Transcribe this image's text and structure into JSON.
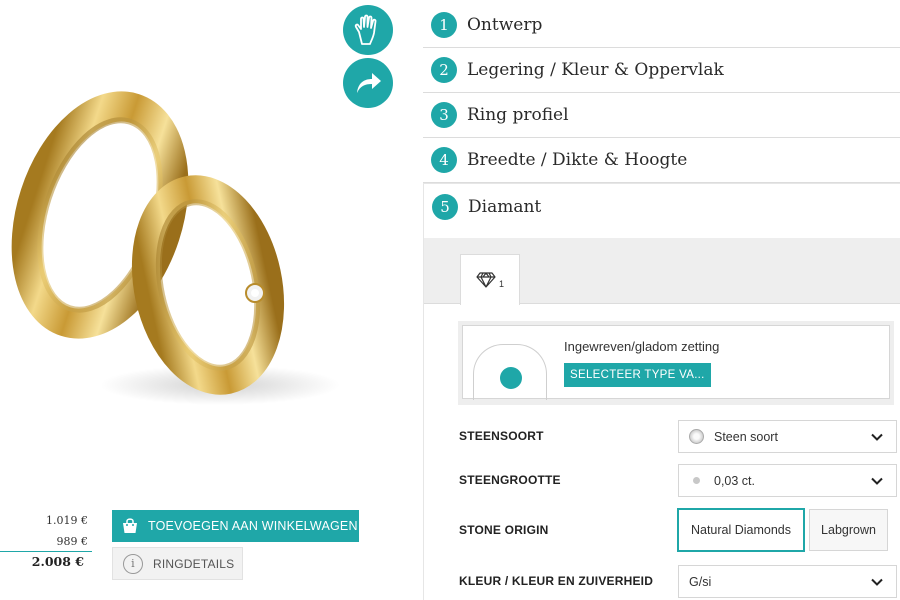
{
  "steps": [
    {
      "num": "1",
      "label": "Ontwerp"
    },
    {
      "num": "2",
      "label": "Legering / Kleur & Oppervlak"
    },
    {
      "num": "3",
      "label": "Ring profiel"
    },
    {
      "num": "4",
      "label": "Breedte / Dikte & Hoogte"
    },
    {
      "num": "5",
      "label": "Diamant"
    }
  ],
  "active_step": "5",
  "tabs": [
    {
      "icon": "diamond-icon",
      "count": "1"
    }
  ],
  "setting": {
    "title": "Ingewreven/gladom zetting",
    "button": "SELECTEER TYPE VA..."
  },
  "options": {
    "stone_type": {
      "label": "STEENSOORT",
      "value": "Steen soort"
    },
    "stone_size": {
      "label": "STEENGROOTTE",
      "value": "0,03 ct."
    },
    "stone_origin": {
      "label": "STONE ORIGIN",
      "choices": [
        "Natural Diamonds",
        "Labgrown"
      ],
      "selected": "Natural Diamonds"
    },
    "color_clarity": {
      "label": "KLEUR / KLEUR EN ZUIVERHEID",
      "value": "G/si"
    }
  },
  "prices": {
    "item1": "1.019 €",
    "item2": "989 €",
    "total": "2.008 €"
  },
  "buttons": {
    "add_to_cart": "TOEVOEGEN AAN WINKELWAGEN",
    "ring_details": "RINGDETAILS"
  },
  "icons": {
    "hand": "hand-icon",
    "share": "share-arrow-icon",
    "cart": "shopping-bag-icon",
    "info": "info-icon",
    "chevron": "chevron-down-icon"
  },
  "colors": {
    "accent": "#1fa7a8",
    "gold": "#d9b24a"
  }
}
